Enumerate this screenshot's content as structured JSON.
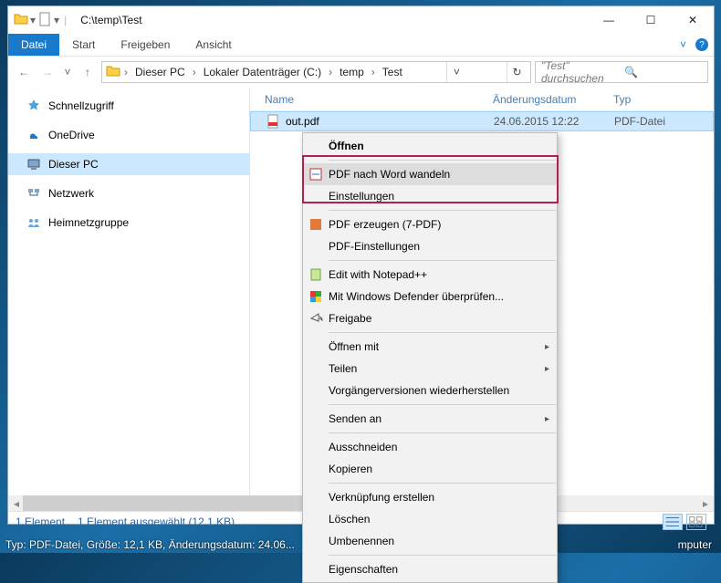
{
  "title_path": "C:\\temp\\Test",
  "ribbon": {
    "file": "Datei",
    "start": "Start",
    "share": "Freigeben",
    "view": "Ansicht"
  },
  "breadcrumbs": [
    "Dieser PC",
    "Lokaler Datenträger (C:)",
    "temp",
    "Test"
  ],
  "search_placeholder": "\"Test\" durchsuchen",
  "tree": {
    "quick": "Schnellzugriff",
    "onedrive": "OneDrive",
    "thispc": "Dieser PC",
    "network": "Netzwerk",
    "homegroup": "Heimnetzgruppe"
  },
  "columns": {
    "name": "Name",
    "date": "Änderungsdatum",
    "type": "Typ"
  },
  "file": {
    "name": "out.pdf",
    "date": "24.06.2015 12:22",
    "type": "PDF-Datei"
  },
  "status": {
    "count": "1 Element",
    "sel": "1 Element ausgewählt (12,1 KB)"
  },
  "ctx": {
    "open": "Öffnen",
    "pdf2word": "PDF nach Word wandeln",
    "settings": "Einstellungen",
    "pdfgen": "PDF erzeugen (7-PDF)",
    "pdfset": "PDF-Einstellungen",
    "notepad": "Edit with Notepad++",
    "defender": "Mit Windows Defender überprüfen...",
    "share": "Freigabe",
    "openwith": "Öffnen mit",
    "sharewith": "Teilen",
    "restore": "Vorgängerversionen wiederherstellen",
    "sendto": "Senden an",
    "cut": "Ausschneiden",
    "copy": "Kopieren",
    "link": "Verknüpfung erstellen",
    "delete": "Löschen",
    "rename": "Umbenennen",
    "props": "Eigenschaften"
  },
  "tray_left": "Typ: PDF-Datei, Größe: 12,1 KB, Änderungsdatum: 24.06...",
  "tray_right": "mputer"
}
